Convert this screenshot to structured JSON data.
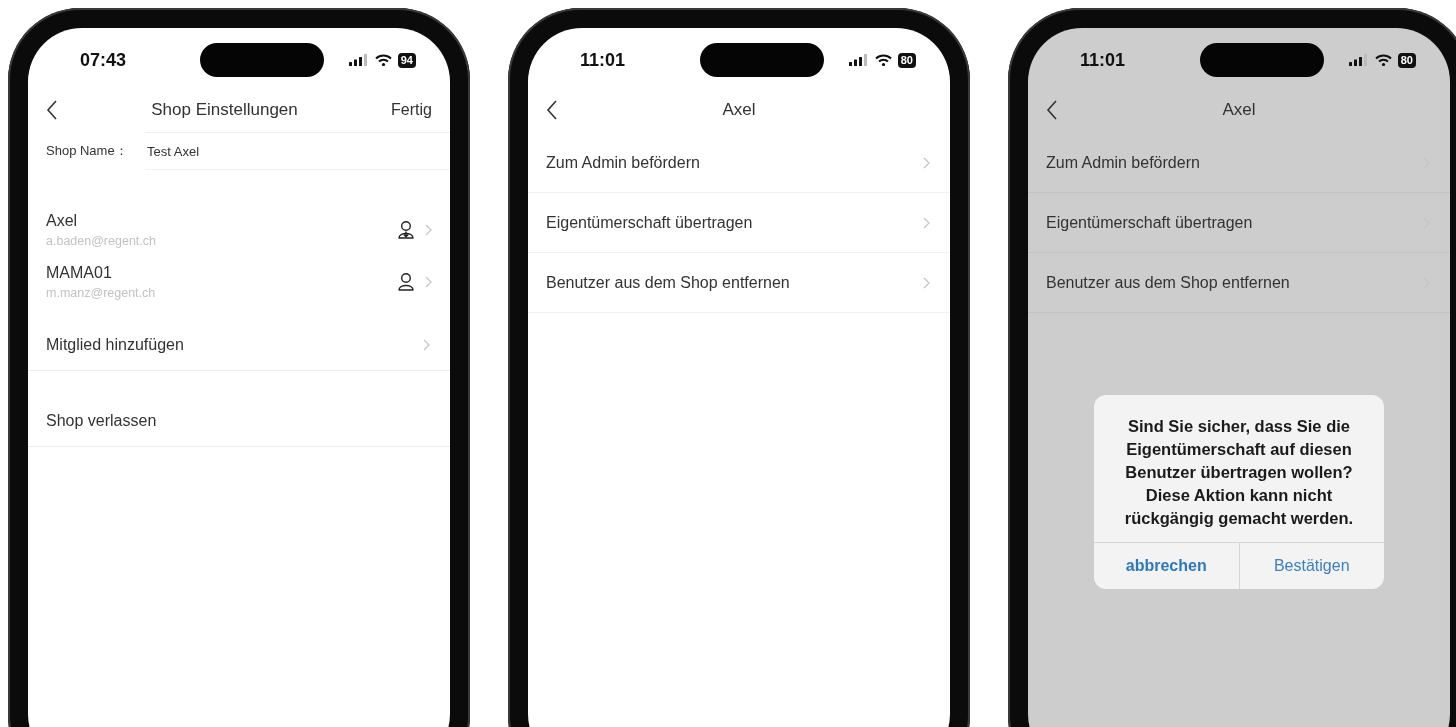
{
  "screens": [
    {
      "kind": "settings",
      "dimmed": false,
      "status_bar": {
        "time": "07:43",
        "battery": "94"
      },
      "nav": {
        "title": "Shop Einstellungen",
        "action": "Fertig"
      },
      "shop_name": {
        "label": "Shop Name：",
        "value": "Test Axel"
      },
      "members": [
        {
          "name": "Axel",
          "email": "a.baden@regent.ch",
          "kind": "owner"
        },
        {
          "name": "MAMA01",
          "email": "m.manz@regent.ch",
          "kind": "member"
        }
      ],
      "items": [
        {
          "label": "Mitglied hinzufügen",
          "kind": "link"
        },
        {
          "label": "Shop verlassen",
          "kind": "action"
        }
      ]
    },
    {
      "kind": "menu",
      "dimmed": false,
      "status_bar": {
        "time": "11:01",
        "battery": "80"
      },
      "nav": {
        "title": "Axel"
      },
      "items": [
        {
          "label": "Zum Admin befördern",
          "kind": "link"
        },
        {
          "label": "Eigentümerschaft übertragen",
          "kind": "link"
        },
        {
          "label": "Benutzer aus dem Shop entfernen",
          "kind": "link"
        }
      ]
    },
    {
      "kind": "menu",
      "dimmed": true,
      "status_bar": {
        "time": "11:01",
        "battery": "80"
      },
      "nav": {
        "title": "Axel"
      },
      "items": [
        {
          "label": "Zum Admin befördern",
          "kind": "link"
        },
        {
          "label": "Eigentümerschaft übertragen",
          "kind": "link"
        },
        {
          "label": "Benutzer aus dem Shop entfernen",
          "kind": "link"
        }
      ],
      "dialog": {
        "message": "Sind Sie sicher, dass Sie die Eigentümerschaft auf diesen Benutzer übertragen wollen? Diese Aktion kann nicht rückgängig gemacht werden.",
        "buttons": [
          {
            "label": "abbrechen",
            "kind": "cancel"
          },
          {
            "label": "Bestätigen",
            "kind": "confirm"
          }
        ]
      }
    }
  ]
}
